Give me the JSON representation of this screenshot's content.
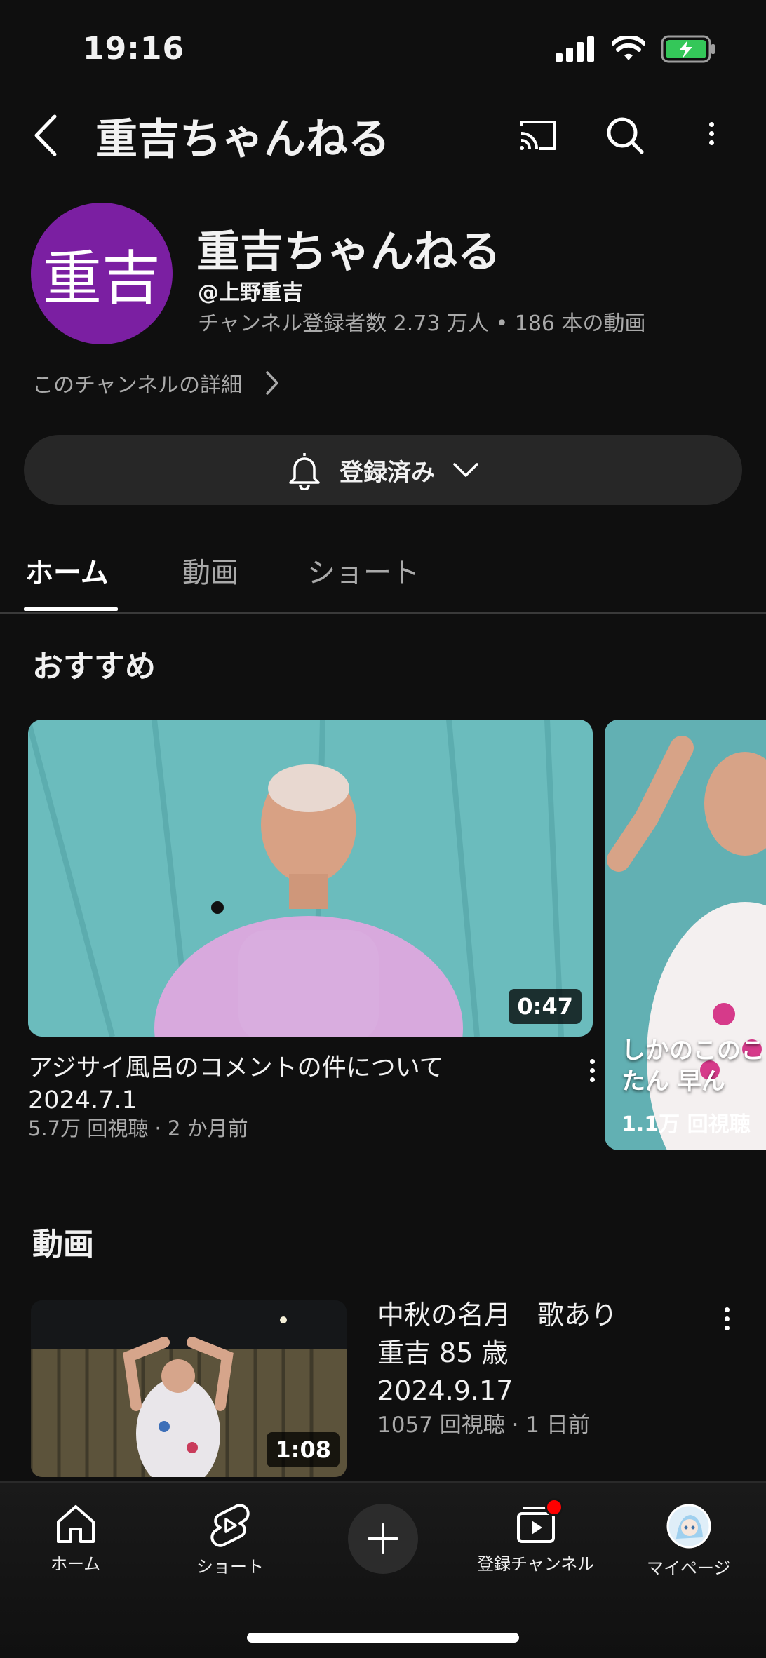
{
  "status": {
    "time": "19:16"
  },
  "header": {
    "title": "重吉ちゃんねる"
  },
  "channel": {
    "avatar_text": "重吉",
    "name": "重吉ちゃんねる",
    "handle": "@上野重吉",
    "stats": "チャンネル登録者数 2.73 万人 • 186 本の動画",
    "details_link": "このチャンネルの詳細"
  },
  "subscribe": {
    "label": "登録済み"
  },
  "tabs": [
    {
      "label": "ホーム",
      "active": true
    },
    {
      "label": "動画",
      "active": false
    },
    {
      "label": "ショート",
      "active": false
    }
  ],
  "recommended": {
    "section_title": "おすすめ",
    "main_video": {
      "title": "アジサイ風呂のコメントの件について 2024.7.1",
      "meta": "5.7万 回視聴 · 2 か月前",
      "duration": "0:47"
    },
    "second_video": {
      "title": "しかのこのこ たんたん 早ん",
      "views": "1.1万 回視聴"
    }
  },
  "videos": {
    "section_title": "動画",
    "items": [
      {
        "title_line1": "中秋の名月　歌あり",
        "title_line2": "重吉 85 歳",
        "title_line3": "2024.9.17",
        "meta": "1057 回視聴 · 1 日前",
        "duration": "1:08"
      }
    ]
  },
  "bottom_nav": [
    {
      "label": "ホーム",
      "icon": "home-icon"
    },
    {
      "label": "ショート",
      "icon": "shorts-icon"
    },
    {
      "label": "",
      "icon": "create-icon"
    },
    {
      "label": "登録チャンネル",
      "icon": "subscriptions-icon"
    },
    {
      "label": "マイページ",
      "icon": "profile-avatar"
    }
  ],
  "colors": {
    "background": "#0f0f0f",
    "avatar": "#7b1fa2",
    "badge": "#ff0000",
    "battery": "#34c759"
  }
}
